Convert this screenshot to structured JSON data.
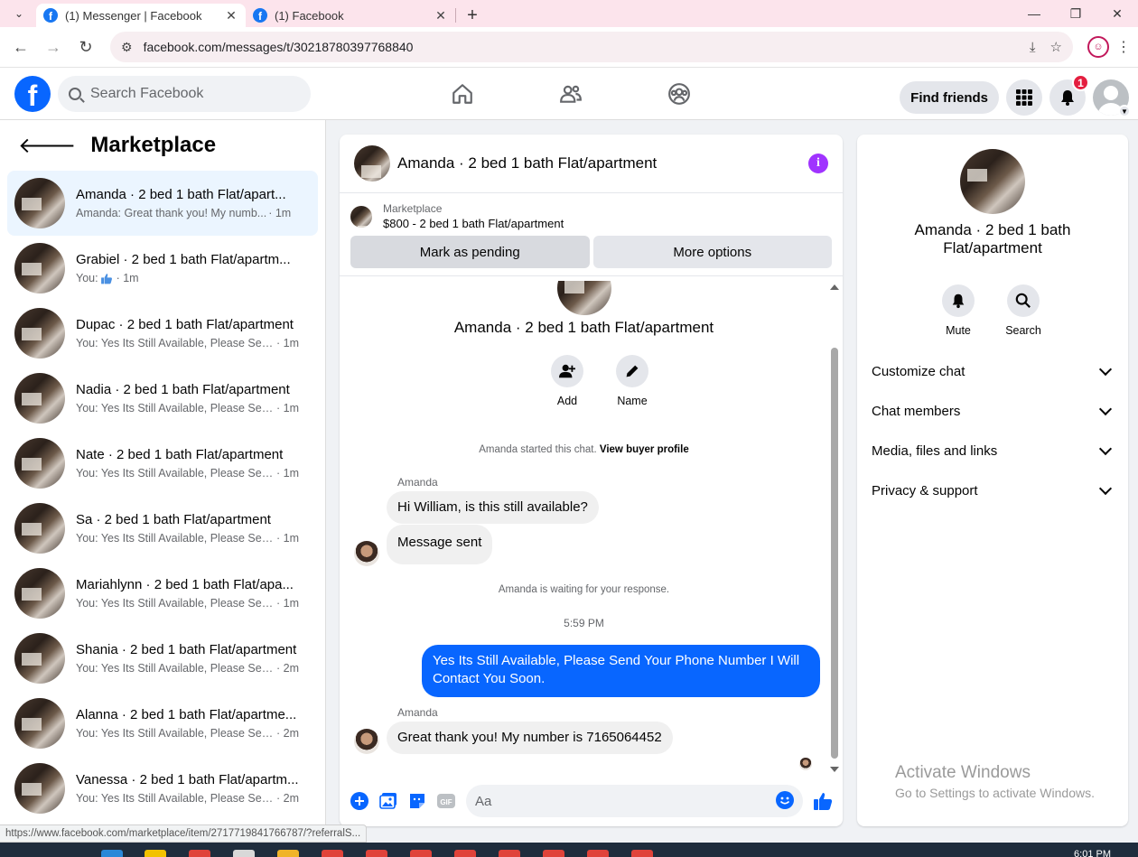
{
  "browser": {
    "tabs": [
      {
        "title": "(1) Messenger | Facebook",
        "active": true
      },
      {
        "title": "(1) Facebook",
        "active": false
      }
    ],
    "url": "facebook.com/messages/t/30218780397768840",
    "status_url": "https://www.facebook.com/marketplace/item/2717719841766787/?referralS..."
  },
  "topnav": {
    "logo": "f",
    "search_placeholder": "Search Facebook",
    "find_friends": "Find friends",
    "notification_count": "1"
  },
  "sidebar": {
    "title": "Marketplace",
    "conversations": [
      {
        "name": "Amanda · 2 bed 1 bath Flat/apart...",
        "snippet": "Amanda: Great thank you! My numb...",
        "time": "· 1m",
        "active": true
      },
      {
        "name": "Grabiel · 2 bed 1 bath Flat/apartm...",
        "snippet": "You: ",
        "time": "· 1m",
        "active": false,
        "thumbs_up": true
      },
      {
        "name": "Dupac · 2 bed 1 bath Flat/apartment",
        "snippet": "You: Yes Its Still Available, Please Sen...",
        "time": "· 1m",
        "active": false
      },
      {
        "name": "Nadia · 2 bed 1 bath Flat/apartment",
        "snippet": "You: Yes Its Still Available, Please Sen...",
        "time": "· 1m",
        "active": false
      },
      {
        "name": "Nate · 2 bed 1 bath Flat/apartment",
        "snippet": "You: Yes Its Still Available, Please Sen...",
        "time": "· 1m",
        "active": false
      },
      {
        "name": "Sa · 2 bed 1 bath Flat/apartment",
        "snippet": "You: Yes Its Still Available, Please Sen...",
        "time": "· 1m",
        "active": false
      },
      {
        "name": "Mariahlynn · 2 bed 1 bath Flat/apa...",
        "snippet": "You: Yes Its Still Available, Please Sen...",
        "time": "· 1m",
        "active": false
      },
      {
        "name": "Shania · 2 bed 1 bath Flat/apartment",
        "snippet": "You: Yes Its Still Available, Please Sen...",
        "time": "· 2m",
        "active": false
      },
      {
        "name": "Alanna · 2 bed 1 bath Flat/apartme...",
        "snippet": "You: Yes Its Still Available, Please Sen...",
        "time": "· 2m",
        "active": false
      },
      {
        "name": "Vanessa · 2 bed 1 bath Flat/apartm...",
        "snippet": "You: Yes Its Still Available, Please Sen...",
        "time": "· 2m",
        "active": false
      }
    ]
  },
  "chat": {
    "title": "Amanda · 2 bed 1 bath Flat/apartment",
    "marketplace_label": "Marketplace",
    "listing": "$800 - 2 bed 1 bath Flat/apartment",
    "mark_pending": "Mark as pending",
    "more_options": "More options",
    "intro_name": "Amanda · 2 bed 1 bath Flat/apartment",
    "add_label": "Add",
    "name_label": "Name",
    "started_text": "Amanda started this chat.",
    "buyer_profile_link": "View buyer profile",
    "sender1": "Amanda",
    "msg1": "Hi William, is this still available?",
    "msg2": "Message sent",
    "waiting_text": "Amanda is waiting for your response.",
    "timestamp": "5:59 PM",
    "msg3": "Yes Its Still Available, Please Send Your Phone Number I Will Contact You Soon.",
    "sender2": "Amanda",
    "msg4": "Great thank you! My number is 7165064452",
    "composer_placeholder": "Aa"
  },
  "rpanel": {
    "name": "Amanda · 2 bed 1 bath Flat/apartment",
    "mute_label": "Mute",
    "search_label": "Search",
    "sections": [
      "Customize chat",
      "Chat members",
      "Media, files and links",
      "Privacy & support"
    ]
  },
  "watermark": {
    "line1": "Activate Windows",
    "line2": "Go to Settings to activate Windows."
  },
  "taskbar": {
    "clock": "6:01 PM"
  },
  "colors": {
    "fb_blue": "#0866ff",
    "accent_purple": "#a033ff",
    "badge_red": "#e41e3f"
  }
}
